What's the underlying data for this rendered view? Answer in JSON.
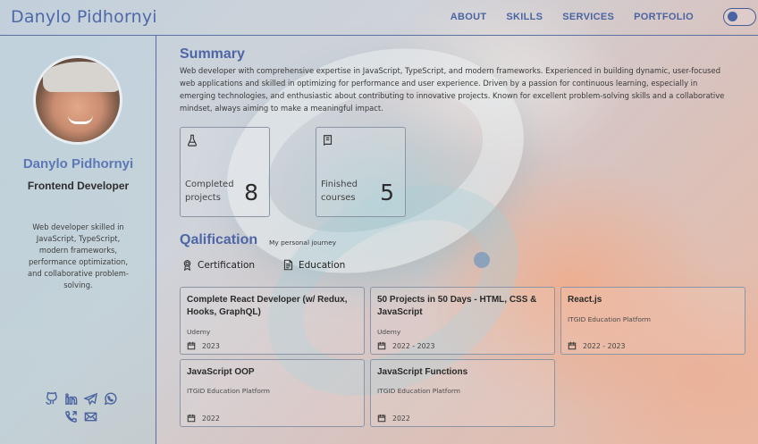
{
  "header": {
    "logo": "Danylo Pidhornyi",
    "nav": [
      "ABOUT",
      "SKILLS",
      "SERVICES",
      "PORTFOLIO"
    ],
    "theme_toggle": "off"
  },
  "sidebar": {
    "name": "Danylo Pidhornyi",
    "role": "Frontend Developer",
    "bio": "Web developer skilled in JavaScript, TypeScript, modern frameworks, performance optimization, and collaborative problem-solving.",
    "social_icons": [
      "github-icon",
      "linkedin-icon",
      "telegram-icon",
      "whatsapp-icon",
      "phone-icon",
      "email-icon"
    ]
  },
  "summary": {
    "title": "Summary",
    "text": "Web developer with comprehensive expertise in JavaScript, TypeScript, and modern frameworks. Experienced in building dynamic, user-focused web applications and skilled in optimizing for performance and user experience. Driven by a passion for continuous learning, especially in emerging technologies, and enthusiastic about contributing to innovative projects. Known for excellent problem-solving skills and a collaborative mindset, always aiming to make a meaningful impact."
  },
  "stats": [
    {
      "label": "Completed projects",
      "value": "8",
      "icon": "flask-icon"
    },
    {
      "label": "Finished courses",
      "value": "5",
      "icon": "book-icon"
    }
  ],
  "qualification": {
    "title": "Qalification",
    "subtitle": "My personal journey",
    "tabs": [
      {
        "label": "Certification",
        "icon": "award-icon"
      },
      {
        "label": "Education",
        "icon": "document-icon"
      }
    ],
    "cards": [
      {
        "title": "Complete React Developer (w/ Redux, Hooks, GraphQL)",
        "org": "Udemy",
        "date": "2023"
      },
      {
        "title": "50 Projects in 50 Days - HTML, CSS & JavaScript",
        "org": "Udemy",
        "date": "2022 - 2023"
      },
      {
        "title": "React.js",
        "org": "ITGID Education Platform",
        "date": "2022 - 2023"
      },
      {
        "title": "JavaScript OOP",
        "org": "ITGID Education Platform",
        "date": "2022"
      },
      {
        "title": "JavaScript Functions",
        "org": "ITGID Education Platform",
        "date": "2022"
      }
    ]
  },
  "colors": {
    "accent": "#4d66a6",
    "border": "#5a6fa3"
  }
}
